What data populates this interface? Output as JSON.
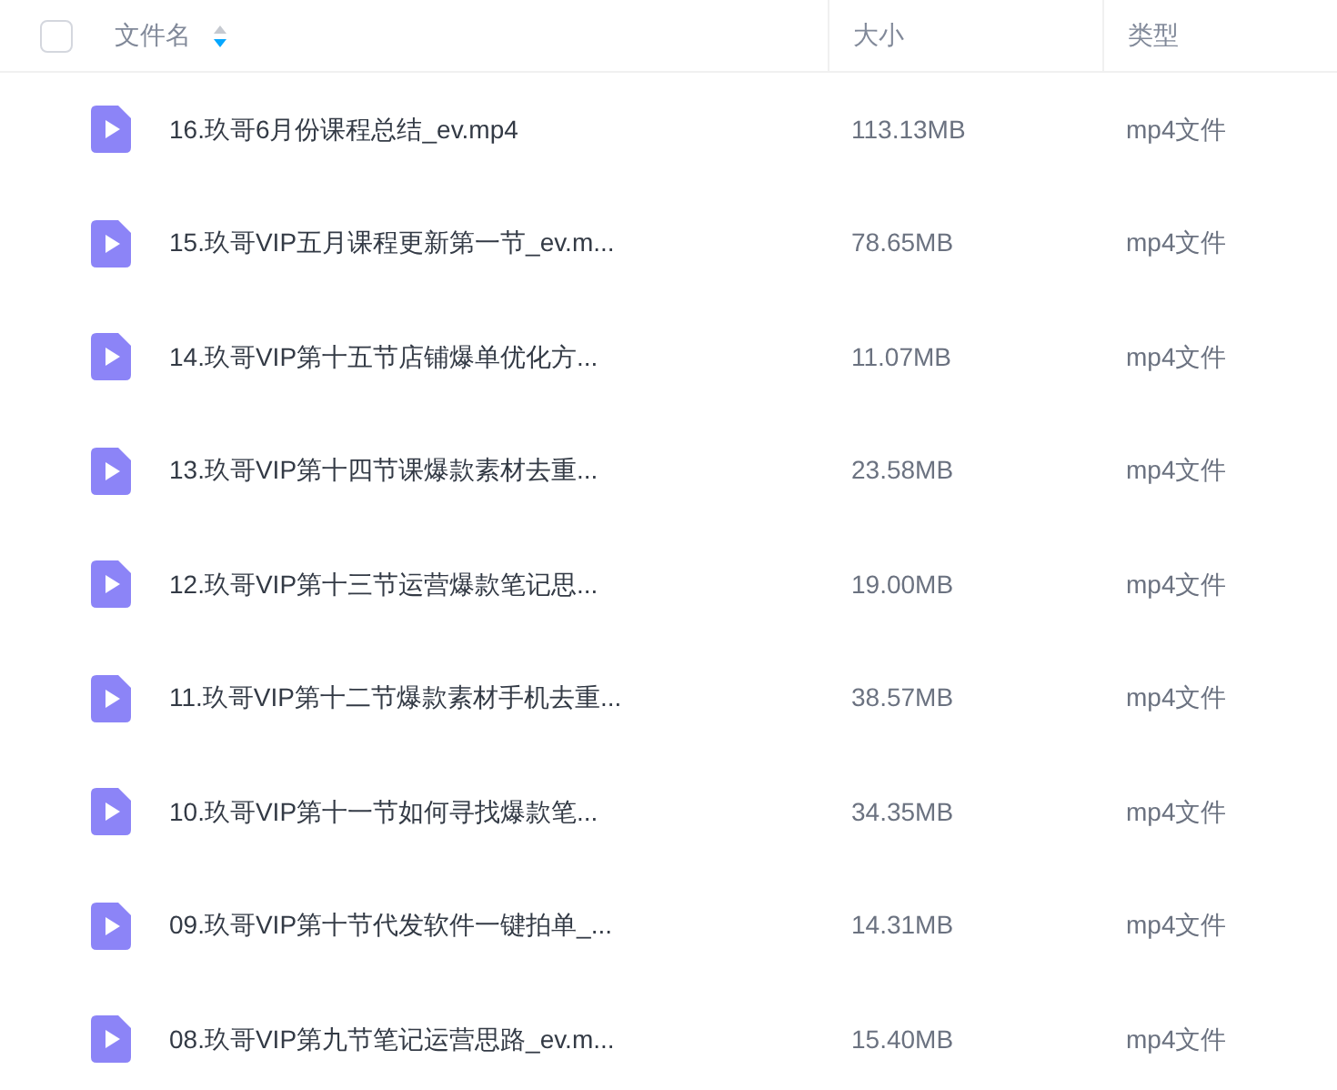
{
  "header": {
    "select_all": {
      "checked": false
    },
    "columns": [
      {
        "label": "文件名",
        "sorted": true,
        "descending": true
      },
      {
        "label": "大小"
      },
      {
        "label": "类型"
      }
    ]
  },
  "rows": [
    {
      "name": "16.玖哥6月份课程总结_ev.mp4",
      "size": "113.13MB",
      "type": "mp4文件"
    },
    {
      "name": "15.玖哥VIP五月课程更新第一节_ev.m...",
      "size": "78.65MB",
      "type": "mp4文件"
    },
    {
      "name": "14.玖哥VIP第十五节店铺爆单优化方...",
      "size": "11.07MB",
      "type": "mp4文件"
    },
    {
      "name": "13.玖哥VIP第十四节课爆款素材去重...",
      "size": "23.58MB",
      "type": "mp4文件"
    },
    {
      "name": "12.玖哥VIP第十三节运营爆款笔记思...",
      "size": "19.00MB",
      "type": "mp4文件"
    },
    {
      "name": "11.玖哥VIP第十二节爆款素材手机去重...",
      "size": "38.57MB",
      "type": "mp4文件"
    },
    {
      "name": "10.玖哥VIP第十一节如何寻找爆款笔...",
      "size": "34.35MB",
      "type": "mp4文件"
    },
    {
      "name": "09.玖哥VIP第十节代发软件一键拍单_...",
      "size": "14.31MB",
      "type": "mp4文件"
    },
    {
      "name": "08.玖哥VIP第九节笔记运营思路_ev.m...",
      "size": "15.40MB",
      "type": "mp4文件"
    }
  ]
}
